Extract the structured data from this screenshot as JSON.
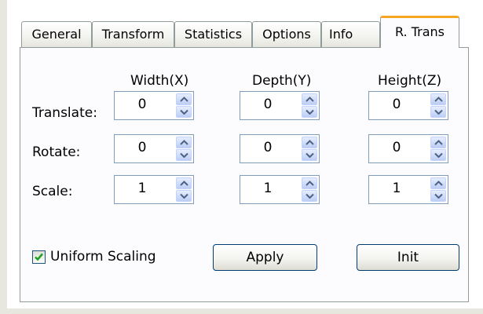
{
  "tabs": [
    {
      "label": "General"
    },
    {
      "label": "Transform"
    },
    {
      "label": "Statistics"
    },
    {
      "label": "Options"
    },
    {
      "label": "Info"
    },
    {
      "label": "R. Trans"
    }
  ],
  "active_tab": "R. Trans",
  "columns": [
    "Width(X)",
    "Depth(Y)",
    "Height(Z)"
  ],
  "rows": [
    {
      "label": "Translate:",
      "values": [
        "0",
        "0",
        "0"
      ]
    },
    {
      "label": "Rotate:",
      "values": [
        "0",
        "0",
        "0"
      ]
    },
    {
      "label": "Scale:",
      "values": [
        "1",
        "1",
        "1"
      ]
    }
  ],
  "uniform_scaling": {
    "label": "Uniform Scaling",
    "checked": true
  },
  "buttons": {
    "apply": "Apply",
    "init": "Init"
  },
  "colors": {
    "active_tab_accent": "#f5a623",
    "checkmark": "#21a121",
    "spin_arrow": "#4d6185",
    "field_border": "#7f9db9"
  },
  "icons": {
    "spin_up": "chevron-up-icon",
    "spin_down": "chevron-down-icon",
    "check": "checkmark-icon"
  }
}
